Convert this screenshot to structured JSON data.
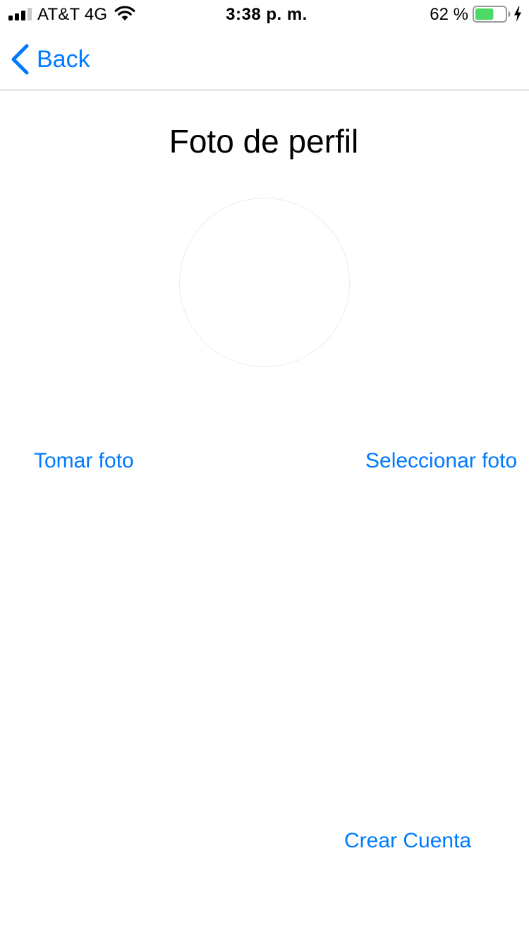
{
  "status_bar": {
    "carrier": "AT&T 4G",
    "time": "3:38 p. m.",
    "battery_percent": "62 %",
    "battery_level": 0.62,
    "battery_color": "#4cd964",
    "icons": [
      "signal-icon",
      "wifi-icon",
      "battery-icon",
      "charging-icon"
    ]
  },
  "nav": {
    "back_label": "Back",
    "accent_color": "#007aff"
  },
  "main": {
    "title": "Foto de perfil",
    "take_photo_label": "Tomar foto",
    "select_photo_label": "Seleccionar foto",
    "create_account_label": "Crear Cuenta"
  }
}
